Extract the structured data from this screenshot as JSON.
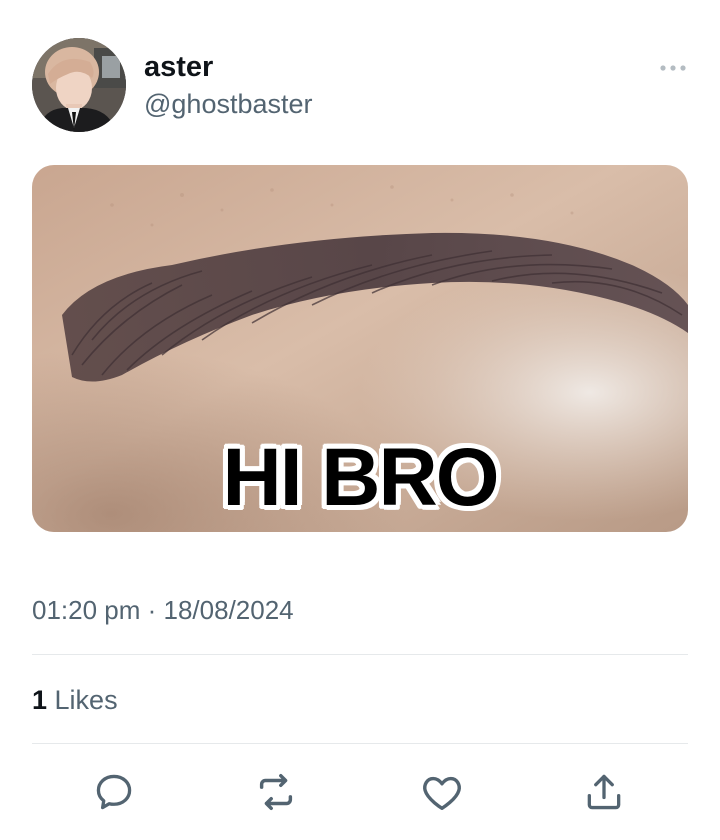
{
  "tweet": {
    "display_name": "aster",
    "handle": "@ghostbaster",
    "media": {
      "caption": "HI BRO"
    },
    "time": "01:20 pm",
    "separator": " · ",
    "date": "18/08/2024",
    "likes_count": "1",
    "likes_label": " Likes"
  },
  "icons": {
    "more": "more-horizontal-icon",
    "reply": "reply-icon",
    "retweet": "retweet-icon",
    "like": "like-icon",
    "share": "share-icon"
  },
  "colors": {
    "text_primary": "#0f1419",
    "text_secondary": "#536471",
    "icon": "#536471",
    "divider": "#e6e9eb"
  }
}
